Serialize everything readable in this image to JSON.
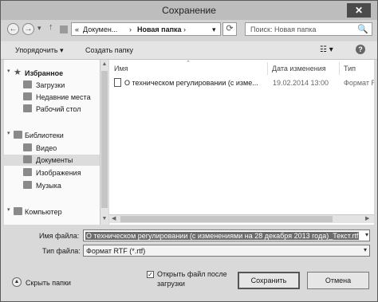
{
  "window": {
    "title": "Сохранение",
    "close_glyph": "✕"
  },
  "nav": {
    "back_icon": "←",
    "forward_icon": "→",
    "up_icon": "↑",
    "breadcrumb": [
      "«",
      "Докумен...",
      "›",
      "Новая папка",
      "›"
    ],
    "refresh_icon": "⟳",
    "search_placeholder": "Поиск: Новая папка",
    "search_icon": "🔍"
  },
  "toolbar": {
    "organize": "Упорядочить ▾",
    "new_folder": "Создать папку",
    "view_icon": "☷ ▾",
    "help_icon": "?"
  },
  "sidebar": {
    "favorites": [
      {
        "label": "Избранное",
        "icon": "star-icon",
        "header": true
      },
      {
        "label": "Загрузки",
        "icon": "downloads-icon"
      },
      {
        "label": "Недавние места",
        "icon": "recent-places-icon"
      },
      {
        "label": "Рабочий стол",
        "icon": "desktop-icon"
      }
    ],
    "libraries": [
      {
        "label": "Библиотеки",
        "icon": "libraries-icon",
        "header": true
      },
      {
        "label": "Видео",
        "icon": "video-icon"
      },
      {
        "label": "Документы",
        "icon": "documents-icon",
        "selected": true
      },
      {
        "label": "Изображения",
        "icon": "images-icon"
      },
      {
        "label": "Музыка",
        "icon": "music-icon"
      }
    ],
    "computer": [
      {
        "label": "Компьютер",
        "icon": "computer-icon",
        "header": true
      }
    ]
  },
  "files": {
    "columns": [
      "Имя",
      "Дата изменения",
      "Тип"
    ],
    "rows": [
      {
        "name": "О техническом регулировании (с изме...",
        "date": "19.02.2014 13:00",
        "type": "Формат R"
      }
    ]
  },
  "form": {
    "filename_label": "Имя файла:",
    "filename_value": "О техническом регулировании (с изменениями на 28 декабря 2013 года)_Текст.rtf",
    "filetype_label": "Тип файла:",
    "filetype_value": "Формат RTF (*.rtf)",
    "open_after_label": "Открыть файл после загрузки",
    "open_after_checked": "✓"
  },
  "footer": {
    "hide_folders": "Скрыть папки",
    "hide_icon": "▲",
    "save": "Сохранить",
    "cancel": "Отмена"
  }
}
